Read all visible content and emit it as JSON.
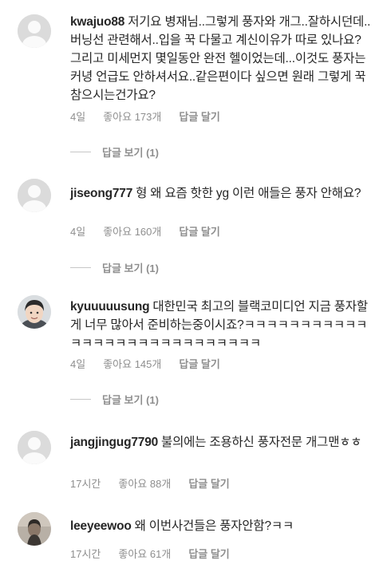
{
  "comments": [
    {
      "username": "kwajuo88",
      "text": "저기요 병재님..그렇게 풍자와 개그..잘하시던데..버닝선 관련해서..입을 꾹 다물고 계신이유가 따로 있나요? 그리고 미세먼지 몇일동안 완전 헬이었는데...이것도 풍자는 커녕 언급도 안하셔서요..같은편이다 싶으면 원래 그렇게 꾹 참으시는건가요?",
      "time": "4일",
      "likes": "좋아요 173개",
      "reply": "답글 달기",
      "view_replies": "답글 보기 (1)"
    },
    {
      "username": "jiseong777",
      "text": "형 왜 요즘 핫한 yg 이런 애들은 풍자 안해요?",
      "time": "4일",
      "likes": "좋아요 160개",
      "reply": "답글 달기",
      "view_replies": "답글 보기 (1)"
    },
    {
      "username": "kyuuuuusung",
      "text": "대한민국 최고의 블랙코미디언 지금 풍자할게 너무 많아서 준비하는중이시죠?ㅋㅋㅋㅋㅋㅋㅋㅋㅋㅋㅋㅋㅋㅋㅋㅋㅋㅋㅋㅋㅋㅋㅋㅋㅋㅋㅋㅋ",
      "time": "4일",
      "likes": "좋아요 145개",
      "reply": "답글 달기",
      "view_replies": "답글 보기 (1)"
    },
    {
      "username": "jangjingug7790",
      "text": "불의에는 조용하신 풍자전문 개그맨ㅎㅎ",
      "time": "17시간",
      "likes": "좋아요 88개",
      "reply": "답글 달기"
    },
    {
      "username": "leeyeewoo",
      "text": "왜 이번사건들은 풍자안함?ㅋㅋ",
      "time": "17시간",
      "likes": "좋아요 61개",
      "reply": "답글 달기"
    }
  ],
  "icons": {
    "default_avatar": "person-silhouette-icon",
    "photo_avatar": "profile-photo"
  },
  "colors": {
    "text": "#262626",
    "meta": "#8e8e8e",
    "avatar_bg": "#dbdbdb"
  }
}
